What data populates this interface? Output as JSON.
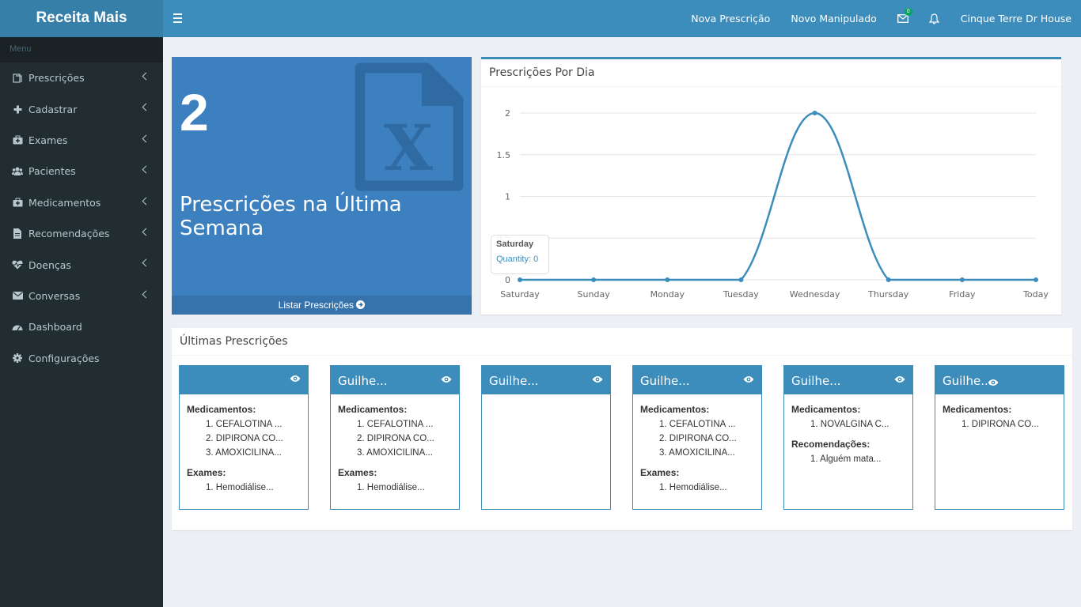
{
  "app": {
    "title": "Receita Mais"
  },
  "topnav": {
    "nova_prescricao": "Nova Prescrição",
    "novo_manipulado": "Novo Manipulado",
    "mail_badge": "0",
    "user": "Cinque Terre Dr House"
  },
  "sidebar": {
    "header": "Menu",
    "items": [
      {
        "label": "Prescrições",
        "icon": "prescription-icon"
      },
      {
        "label": "Cadastrar",
        "icon": "plus-icon"
      },
      {
        "label": "Exames",
        "icon": "medkit-icon"
      },
      {
        "label": "Pacientes",
        "icon": "users-icon"
      },
      {
        "label": "Medicamentos",
        "icon": "medkit-icon"
      },
      {
        "label": "Recomendações",
        "icon": "file-icon"
      },
      {
        "label": "Doenças",
        "icon": "heartbeat-icon"
      },
      {
        "label": "Conversas",
        "icon": "envelope-icon"
      },
      {
        "label": "Dashboard",
        "icon": "dashboard-icon"
      },
      {
        "label": "Configurações",
        "icon": "gear-icon"
      }
    ]
  },
  "stat": {
    "count": "2",
    "label": "Prescrições na Última Semana",
    "footer": "Listar Prescrições"
  },
  "chart_box": {
    "title": "Prescrições Por Dia",
    "tooltip": {
      "title": "Saturday",
      "label": "Quantity: 0"
    }
  },
  "chart_data": {
    "type": "line",
    "categories": [
      "Saturday",
      "Sunday",
      "Monday",
      "Tuesday",
      "Wednesday",
      "Thursday",
      "Friday",
      "Today"
    ],
    "series": [
      {
        "name": "Quantity",
        "values": [
          0,
          0,
          0,
          0,
          2,
          0,
          0,
          0
        ]
      }
    ],
    "yticks": [
      "0",
      "0.5",
      "1",
      "1.5",
      "2"
    ],
    "ylim": [
      0,
      2
    ],
    "grid": true,
    "color": "#3c8dbc"
  },
  "ultimas": {
    "title": "Últimas Prescrições",
    "cards": [
      {
        "name": "",
        "sections": [
          {
            "title": "Medicamentos:",
            "items": [
              "1. CEFALOTINA ...",
              "2. DIPIRONA CO...",
              "3. AMOXICILINA..."
            ]
          },
          {
            "title": "Exames:",
            "items": [
              "1. Hemodiálise..."
            ]
          }
        ]
      },
      {
        "name": "Guilhe...",
        "sections": [
          {
            "title": "Medicamentos:",
            "items": [
              "1. CEFALOTINA ...",
              "2. DIPIRONA CO...",
              "3. AMOXICILINA..."
            ]
          },
          {
            "title": "Exames:",
            "items": [
              "1. Hemodiálise..."
            ]
          }
        ]
      },
      {
        "name": "Guilhe...",
        "sections": []
      },
      {
        "name": "Guilhe...",
        "sections": [
          {
            "title": "Medicamentos:",
            "items": [
              "1. CEFALOTINA ...",
              "2. DIPIRONA CO...",
              "3. AMOXICILINA..."
            ]
          },
          {
            "title": "Exames:",
            "items": [
              "1. Hemodiálise..."
            ]
          }
        ]
      },
      {
        "name": "Guilhe...",
        "sections": [
          {
            "title": "Medicamentos:",
            "items": [
              "1. NOVALGINA C..."
            ]
          },
          {
            "title": "Recomendações:",
            "items": [
              "1. Alguém mata..."
            ]
          }
        ]
      },
      {
        "name": "Guilhe...",
        "sections": [
          {
            "title": "Medicamentos:",
            "items": [
              "1. DIPIRONA CO..."
            ]
          }
        ]
      }
    ]
  }
}
